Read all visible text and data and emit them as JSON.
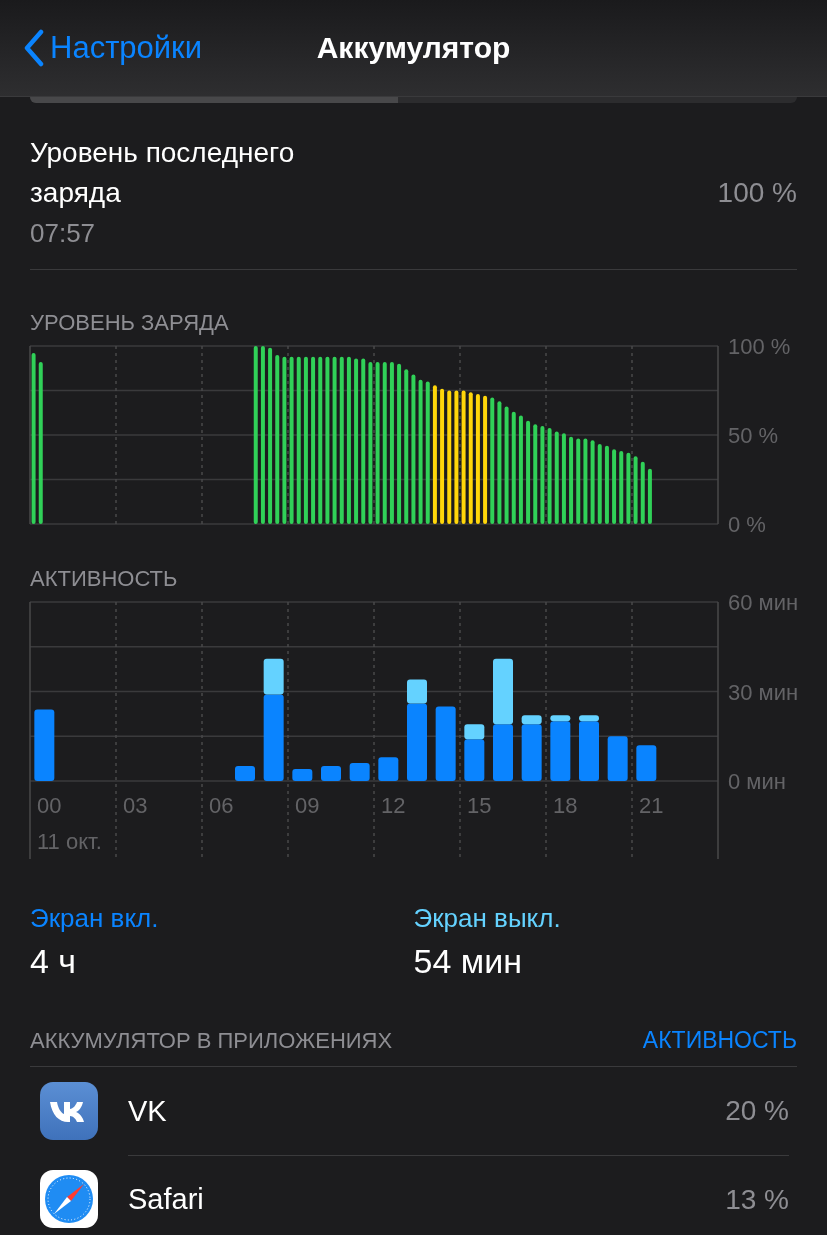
{
  "nav": {
    "back": "Настройки",
    "title": "Аккумулятор"
  },
  "last_charge": {
    "label": "Уровень последнего заряда",
    "time": "07:57",
    "value": "100 %"
  },
  "battery_chart": {
    "chart_data": {
      "type": "bar",
      "title": "УРОВЕНЬ ЗАРЯДА",
      "ylim": [
        0,
        100
      ],
      "yticks": [
        {
          "value": 0,
          "label": "0 %"
        },
        {
          "value": 50,
          "label": "50 %"
        },
        {
          "value": 100,
          "label": "100 %"
        }
      ],
      "series": [
        {
          "color": "#30d158",
          "values": [
            96,
            91,
            null,
            null,
            null,
            null,
            null,
            null,
            null,
            null,
            null,
            null,
            null,
            null,
            null,
            null,
            null,
            null,
            null,
            null,
            null,
            null,
            null,
            null,
            null,
            null,
            null,
            null,
            null,
            null,
            null,
            100,
            100,
            99,
            95,
            94,
            94,
            94,
            94,
            94,
            94,
            94,
            94,
            94,
            94,
            93,
            93,
            91,
            91,
            91,
            91,
            90,
            87,
            84,
            81,
            80,
            null,
            null,
            null,
            null,
            null,
            null,
            null,
            null,
            71,
            69,
            66,
            63,
            61,
            58,
            56,
            55,
            54,
            52,
            51,
            49,
            48,
            48,
            47,
            45,
            44,
            42,
            41,
            40,
            38,
            35,
            31,
            null,
            null,
            null,
            null,
            null,
            null,
            null,
            null,
            null
          ]
        },
        {
          "color": "#ffd60a",
          "values": [
            null,
            null,
            null,
            null,
            null,
            null,
            null,
            null,
            null,
            null,
            null,
            null,
            null,
            null,
            null,
            null,
            null,
            null,
            null,
            null,
            null,
            null,
            null,
            null,
            null,
            null,
            null,
            null,
            null,
            null,
            null,
            null,
            null,
            null,
            null,
            null,
            null,
            null,
            null,
            null,
            null,
            null,
            null,
            null,
            null,
            null,
            null,
            null,
            null,
            null,
            null,
            null,
            null,
            null,
            null,
            null,
            78,
            76,
            75,
            75,
            75,
            74,
            73,
            72,
            null,
            null,
            null,
            null,
            null,
            null,
            null,
            null,
            null,
            null,
            null,
            null,
            null,
            null,
            null,
            null,
            null,
            null,
            null,
            null,
            null,
            null,
            null,
            null,
            null,
            null,
            null,
            null
          ]
        }
      ]
    }
  },
  "activity_chart": {
    "chart_data": {
      "type": "bar",
      "title": "АКТИВНОСТЬ",
      "stacked": true,
      "ylim": [
        0,
        60
      ],
      "yticks": [
        {
          "value": 0,
          "label": "0 мин"
        },
        {
          "value": 30,
          "label": "30 мин"
        },
        {
          "value": 60,
          "label": "60 мин"
        }
      ],
      "x": [
        0,
        7,
        8,
        9,
        10,
        11,
        12,
        13,
        14,
        15,
        16,
        17,
        18,
        19,
        20,
        21
      ],
      "xticks": [
        {
          "value": 0,
          "label": "00"
        },
        {
          "value": 3,
          "label": "03"
        },
        {
          "value": 6,
          "label": "06"
        },
        {
          "value": 9,
          "label": "09"
        },
        {
          "value": 12,
          "label": "12"
        },
        {
          "value": 15,
          "label": "15"
        },
        {
          "value": 18,
          "label": "18"
        },
        {
          "value": 21,
          "label": "21"
        }
      ],
      "xlim": [
        -0.5,
        23.5
      ],
      "annotations": [
        "11 окт."
      ],
      "series": [
        {
          "name": "Экран вкл.",
          "color": "#0a84ff",
          "values": [
            24,
            5,
            29,
            4,
            5,
            6,
            8,
            26,
            25,
            14,
            19,
            19,
            20,
            20,
            15,
            12
          ]
        },
        {
          "name": "Экран выкл.",
          "color": "#64d2ff",
          "values": [
            0,
            0,
            12,
            0,
            0,
            0,
            0,
            8,
            0,
            5,
            22,
            3,
            2,
            2,
            0,
            0
          ]
        }
      ]
    }
  },
  "screen_stats": [
    {
      "value": "4 ч"
    },
    {
      "value": "54 мин"
    }
  ],
  "apps_section": {
    "title": "АККУМУЛЯТОР В ПРИЛОЖЕНИЯХ",
    "action": "АКТИВНОСТЬ"
  },
  "apps": [
    {
      "kind": "vk",
      "name": "VK",
      "value": "20 %"
    },
    {
      "kind": "safari",
      "name": "Safari",
      "value": "13 %"
    }
  ]
}
